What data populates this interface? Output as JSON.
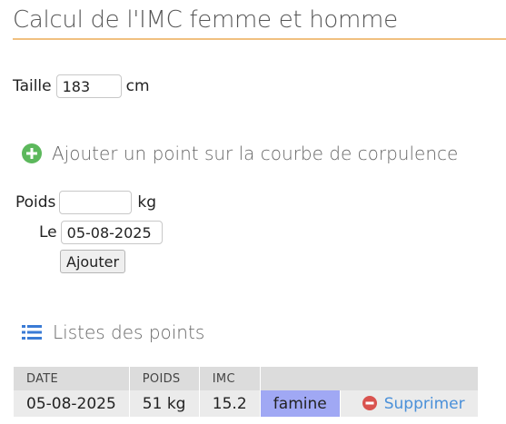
{
  "page": {
    "title": "Calcul de l'IMC femme et homme"
  },
  "taille": {
    "label": "Taille",
    "value": "183",
    "unit": "cm"
  },
  "add_section": {
    "icon": "plus-circle-icon",
    "title": "Ajouter un point sur la courbe de corpulence",
    "poids_label": "Poids",
    "poids_value": "",
    "poids_unit": "kg",
    "date_label": "Le",
    "date_value": "05-08-2025",
    "submit_label": "Ajouter"
  },
  "list_section": {
    "icon": "list-icon",
    "title": "Listes des points",
    "columns": [
      "DATE",
      "POIDS",
      "IMC",
      ""
    ],
    "rows": [
      {
        "date": "05-08-2025",
        "poids": "51 kg",
        "imc": "15.2",
        "status": "famine",
        "action": "Supprimer"
      }
    ]
  },
  "colors": {
    "accent_rule": "#f0c080",
    "status_famine": "#a0a8f4",
    "link": "#4a90d9",
    "add_icon": "#5cb85c",
    "delete_icon": "#d9534f"
  }
}
